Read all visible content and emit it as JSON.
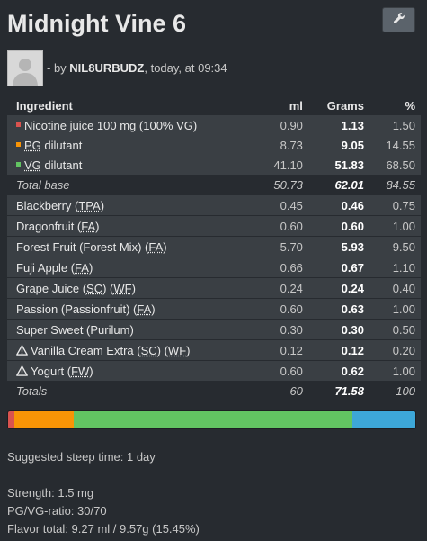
{
  "recipe": {
    "title": "Midnight Vine 6",
    "author_prefix": "- by ",
    "author": "NIL8URBUDZ",
    "date_text": ", today, at 09:34"
  },
  "table": {
    "headers": {
      "ingredient": "Ingredient",
      "ml": "ml",
      "grams": "Grams",
      "percent": "%"
    },
    "base": [
      {
        "name": "Nicotine juice 100 mg (100% VG)",
        "ml": "0.90",
        "grams": "1.13",
        "percent": "1.50",
        "color": "#d9534f"
      },
      {
        "name_prefix": "",
        "abbr": "PG",
        "name_suffix": " dilutant",
        "ml": "8.73",
        "grams": "9.05",
        "percent": "14.55",
        "color": "#f89406"
      },
      {
        "name_prefix": "",
        "abbr": "VG",
        "name_suffix": " dilutant",
        "ml": "41.10",
        "grams": "51.83",
        "percent": "68.50",
        "color": "#62c462"
      }
    ],
    "total_base": {
      "label": "Total base",
      "ml": "50.73",
      "grams": "62.01",
      "percent": "84.55"
    },
    "flavors": [
      {
        "name": "Blackberry (",
        "abbr": "TPA",
        "close": ")",
        "ml": "0.45",
        "grams": "0.46",
        "percent": "0.75"
      },
      {
        "name": "Dragonfruit (",
        "abbr": "FA",
        "close": ")",
        "ml": "0.60",
        "grams": "0.60",
        "percent": "1.00"
      },
      {
        "name": "Forest Fruit (Forest Mix) (",
        "abbr": "FA",
        "close": ")",
        "ml": "5.70",
        "grams": "5.93",
        "percent": "9.50"
      },
      {
        "name": "Fuji Apple (",
        "abbr": "FA",
        "close": ")",
        "ml": "0.66",
        "grams": "0.67",
        "percent": "1.10"
      },
      {
        "name": "Grape Juice (",
        "abbr": "SC",
        "mid": ") (",
        "abbr2": "WF",
        "close": ")",
        "ml": "0.24",
        "grams": "0.24",
        "percent": "0.40"
      },
      {
        "name": "Passion (Passionfruit) (",
        "abbr": "FA",
        "close": ")",
        "ml": "0.60",
        "grams": "0.63",
        "percent": "1.00"
      },
      {
        "name": "Super Sweet (Purilum)",
        "ml": "0.30",
        "grams": "0.30",
        "percent": "0.50"
      },
      {
        "name": "Vanilla Cream Extra (",
        "abbr": "SC",
        "mid": ") (",
        "abbr2": "WF",
        "close": ")",
        "ml": "0.12",
        "grams": "0.12",
        "percent": "0.20",
        "warning": true
      },
      {
        "name": "Yogurt (",
        "abbr": "FW",
        "close": ")",
        "ml": "0.60",
        "grams": "0.62",
        "percent": "1.00",
        "warning": true
      }
    ],
    "totals": {
      "label": "Totals",
      "ml": "60",
      "grams": "71.58",
      "percent": "100"
    }
  },
  "ratio_bar": {
    "segments": [
      {
        "name": "nicotine",
        "percent": 1.5,
        "color": "#d9534f"
      },
      {
        "name": "pg",
        "percent": 14.55,
        "color": "#f89406"
      },
      {
        "name": "vg",
        "percent": 68.5,
        "color": "#62c462"
      },
      {
        "name": "flavor",
        "percent": 15.45,
        "color": "#3da7d8"
      }
    ]
  },
  "info": {
    "steep": "Suggested steep time: 1 day",
    "strength": "Strength: 1.5 mg",
    "ratio": "PG/VG-ratio: 30/70",
    "flavor_total": "Flavor total: 9.27 ml / 9.57g (15.45%)"
  },
  "icons": {
    "wrench": "wrench-icon",
    "warning": "warning-icon",
    "avatar": "avatar-placeholder"
  }
}
